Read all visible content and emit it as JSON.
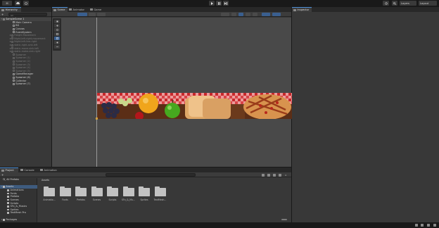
{
  "toolbar": {
    "account_label": "M",
    "layers_label": "Layers",
    "layout_label": "Layout"
  },
  "hierarchy": {
    "tab_label": "Hierarchy",
    "search_placeholder": "All",
    "scene_name": "SampleScene 1",
    "items": [
      {
        "label": "Main Camera",
        "dim": false
      },
      {
        "label": "BG",
        "dim": false
      },
      {
        "label": "Canvas",
        "dim": false
      },
      {
        "label": "EventSystem",
        "dim": false
      },
      {
        "label": "Freight Movement",
        "dim": true
      },
      {
        "label": "Night-left-right-movement",
        "dim": true
      },
      {
        "label": "Night-left-line-right",
        "dim": true
      },
      {
        "label": "static-right-sink-left",
        "dim": true
      },
      {
        "label": "static-move-sink-left",
        "dim": true
      },
      {
        "label": "static-make-sink-right",
        "dim": true
      },
      {
        "label": "Spawner",
        "dim": true
      },
      {
        "label": "Spawner (1)",
        "dim": true
      },
      {
        "label": "Spawner (2)",
        "dim": true
      },
      {
        "label": "Spawner (3)",
        "dim": true
      },
      {
        "label": "Spawner (4)",
        "dim": true
      },
      {
        "label": "Spawner (5)",
        "dim": true
      },
      {
        "label": "GameManager",
        "dim": false
      },
      {
        "label": "Spawner (6)",
        "dim": false
      },
      {
        "label": "Collector",
        "dim": false
      },
      {
        "label": "Spawner (7)",
        "dim": false
      }
    ]
  },
  "center_tabs": [
    "Scene",
    "Animator",
    "Game"
  ],
  "inspector": {
    "tab_label": "Inspector"
  },
  "bottom_tabs": [
    "Project",
    "Console",
    "Animation"
  ],
  "project": {
    "favorites_label": "All Prefabs",
    "assets_root": "Assets",
    "tree": [
      "Animations",
      "Fonts",
      "Prefabs",
      "Scenes",
      "Scripts",
      "SFx_&_Musics",
      "Sprites",
      "TextMesh Pro"
    ],
    "packages_label": "Packages",
    "breadcrumb": "Assets",
    "folders": [
      "Animatio...",
      "Fonts",
      "Prefabs",
      "Scenes",
      "Scripts",
      "SFx_&_Mu...",
      "Sprites",
      "TextMesh..."
    ],
    "count_label": "4"
  }
}
